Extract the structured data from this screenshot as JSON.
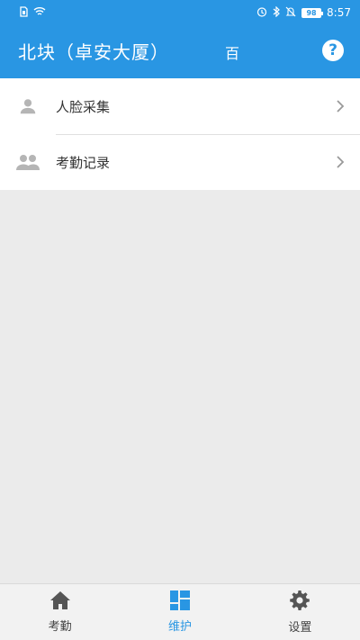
{
  "status_bar": {
    "battery": "98",
    "time": "8:57",
    "left_icons": [
      "sim-icon",
      "wifi-icon"
    ],
    "right_icons": [
      "alarm-icon",
      "bluetooth-icon",
      "mute-bell-icon"
    ]
  },
  "header": {
    "title": "北块（卓安大厦）",
    "title_fragment": "百",
    "help_label": "?"
  },
  "menu": {
    "items": [
      {
        "label": "人脸采集",
        "icon": "person-icon"
      },
      {
        "label": "考勤记录",
        "icon": "people-icon"
      }
    ]
  },
  "tabs": [
    {
      "label": "考勤",
      "icon": "home-icon",
      "active": false
    },
    {
      "label": "维护",
      "icon": "dashboard-icon",
      "active": true
    },
    {
      "label": "设置",
      "icon": "gear-icon",
      "active": false
    }
  ],
  "colors": {
    "primary": "#2996e3",
    "background": "#ebebeb",
    "tabbar": "#f2f2f2"
  }
}
